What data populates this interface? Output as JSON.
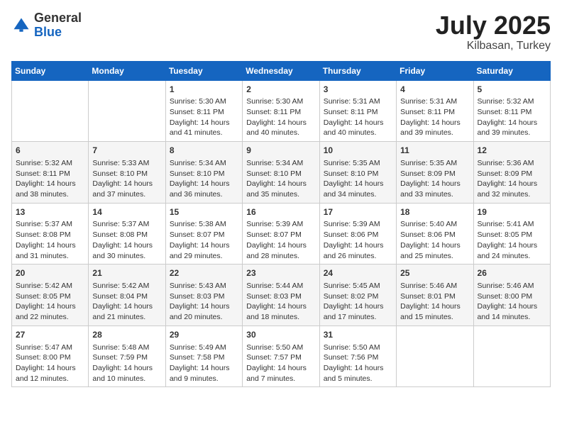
{
  "logo": {
    "general": "General",
    "blue": "Blue"
  },
  "title": {
    "month_year": "July 2025",
    "location": "Kilbasan, Turkey"
  },
  "days_of_week": [
    "Sunday",
    "Monday",
    "Tuesday",
    "Wednesday",
    "Thursday",
    "Friday",
    "Saturday"
  ],
  "weeks": [
    [
      {
        "day": "",
        "content": ""
      },
      {
        "day": "",
        "content": ""
      },
      {
        "day": "1",
        "content": "Sunrise: 5:30 AM\nSunset: 8:11 PM\nDaylight: 14 hours and 41 minutes."
      },
      {
        "day": "2",
        "content": "Sunrise: 5:30 AM\nSunset: 8:11 PM\nDaylight: 14 hours and 40 minutes."
      },
      {
        "day": "3",
        "content": "Sunrise: 5:31 AM\nSunset: 8:11 PM\nDaylight: 14 hours and 40 minutes."
      },
      {
        "day": "4",
        "content": "Sunrise: 5:31 AM\nSunset: 8:11 PM\nDaylight: 14 hours and 39 minutes."
      },
      {
        "day": "5",
        "content": "Sunrise: 5:32 AM\nSunset: 8:11 PM\nDaylight: 14 hours and 39 minutes."
      }
    ],
    [
      {
        "day": "6",
        "content": "Sunrise: 5:32 AM\nSunset: 8:11 PM\nDaylight: 14 hours and 38 minutes."
      },
      {
        "day": "7",
        "content": "Sunrise: 5:33 AM\nSunset: 8:10 PM\nDaylight: 14 hours and 37 minutes."
      },
      {
        "day": "8",
        "content": "Sunrise: 5:34 AM\nSunset: 8:10 PM\nDaylight: 14 hours and 36 minutes."
      },
      {
        "day": "9",
        "content": "Sunrise: 5:34 AM\nSunset: 8:10 PM\nDaylight: 14 hours and 35 minutes."
      },
      {
        "day": "10",
        "content": "Sunrise: 5:35 AM\nSunset: 8:10 PM\nDaylight: 14 hours and 34 minutes."
      },
      {
        "day": "11",
        "content": "Sunrise: 5:35 AM\nSunset: 8:09 PM\nDaylight: 14 hours and 33 minutes."
      },
      {
        "day": "12",
        "content": "Sunrise: 5:36 AM\nSunset: 8:09 PM\nDaylight: 14 hours and 32 minutes."
      }
    ],
    [
      {
        "day": "13",
        "content": "Sunrise: 5:37 AM\nSunset: 8:08 PM\nDaylight: 14 hours and 31 minutes."
      },
      {
        "day": "14",
        "content": "Sunrise: 5:37 AM\nSunset: 8:08 PM\nDaylight: 14 hours and 30 minutes."
      },
      {
        "day": "15",
        "content": "Sunrise: 5:38 AM\nSunset: 8:07 PM\nDaylight: 14 hours and 29 minutes."
      },
      {
        "day": "16",
        "content": "Sunrise: 5:39 AM\nSunset: 8:07 PM\nDaylight: 14 hours and 28 minutes."
      },
      {
        "day": "17",
        "content": "Sunrise: 5:39 AM\nSunset: 8:06 PM\nDaylight: 14 hours and 26 minutes."
      },
      {
        "day": "18",
        "content": "Sunrise: 5:40 AM\nSunset: 8:06 PM\nDaylight: 14 hours and 25 minutes."
      },
      {
        "day": "19",
        "content": "Sunrise: 5:41 AM\nSunset: 8:05 PM\nDaylight: 14 hours and 24 minutes."
      }
    ],
    [
      {
        "day": "20",
        "content": "Sunrise: 5:42 AM\nSunset: 8:05 PM\nDaylight: 14 hours and 22 minutes."
      },
      {
        "day": "21",
        "content": "Sunrise: 5:42 AM\nSunset: 8:04 PM\nDaylight: 14 hours and 21 minutes."
      },
      {
        "day": "22",
        "content": "Sunrise: 5:43 AM\nSunset: 8:03 PM\nDaylight: 14 hours and 20 minutes."
      },
      {
        "day": "23",
        "content": "Sunrise: 5:44 AM\nSunset: 8:03 PM\nDaylight: 14 hours and 18 minutes."
      },
      {
        "day": "24",
        "content": "Sunrise: 5:45 AM\nSunset: 8:02 PM\nDaylight: 14 hours and 17 minutes."
      },
      {
        "day": "25",
        "content": "Sunrise: 5:46 AM\nSunset: 8:01 PM\nDaylight: 14 hours and 15 minutes."
      },
      {
        "day": "26",
        "content": "Sunrise: 5:46 AM\nSunset: 8:00 PM\nDaylight: 14 hours and 14 minutes."
      }
    ],
    [
      {
        "day": "27",
        "content": "Sunrise: 5:47 AM\nSunset: 8:00 PM\nDaylight: 14 hours and 12 minutes."
      },
      {
        "day": "28",
        "content": "Sunrise: 5:48 AM\nSunset: 7:59 PM\nDaylight: 14 hours and 10 minutes."
      },
      {
        "day": "29",
        "content": "Sunrise: 5:49 AM\nSunset: 7:58 PM\nDaylight: 14 hours and 9 minutes."
      },
      {
        "day": "30",
        "content": "Sunrise: 5:50 AM\nSunset: 7:57 PM\nDaylight: 14 hours and 7 minutes."
      },
      {
        "day": "31",
        "content": "Sunrise: 5:50 AM\nSunset: 7:56 PM\nDaylight: 14 hours and 5 minutes."
      },
      {
        "day": "",
        "content": ""
      },
      {
        "day": "",
        "content": ""
      }
    ]
  ]
}
